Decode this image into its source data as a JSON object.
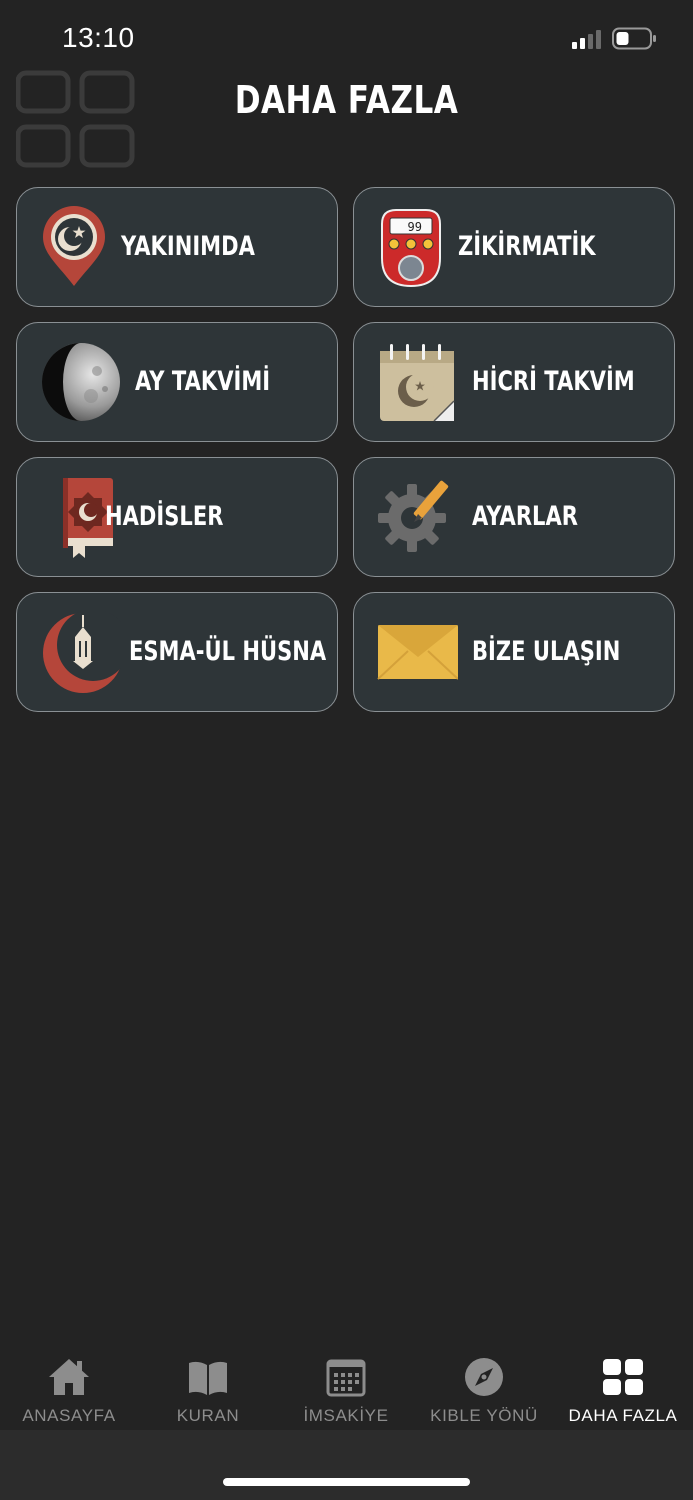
{
  "status_bar": {
    "time": "13:10",
    "signal_icon": "cellular-signal-icon",
    "battery_icon": "battery-icon"
  },
  "header": {
    "title": "DAHA FAZLA",
    "icon": "grid-icon"
  },
  "menu": {
    "items": [
      {
        "label": "YAKINIMDA",
        "icon": "location-pin-icon"
      },
      {
        "label": "ZİKİRMATİK",
        "icon": "tally-counter-icon"
      },
      {
        "label": "AY TAKVİMİ",
        "icon": "moon-icon"
      },
      {
        "label": "HİCRİ TAKVİM",
        "icon": "calendar-icon"
      },
      {
        "label": "HADİSLER",
        "icon": "book-icon"
      },
      {
        "label": "AYARLAR",
        "icon": "settings-gear-icon"
      },
      {
        "label": "ESMA-ÜL HÜSNA",
        "icon": "crescent-lantern-icon"
      },
      {
        "label": "BİZE ULAŞIN",
        "icon": "envelope-icon"
      }
    ]
  },
  "tab_bar": {
    "tabs": [
      {
        "label": "ANASAYFA",
        "icon": "home-icon",
        "active": false
      },
      {
        "label": "KURAN",
        "icon": "open-book-icon",
        "active": false
      },
      {
        "label": "İMSAKİYE",
        "icon": "calendar-grid-icon",
        "active": false
      },
      {
        "label": "KIBLE YÖNÜ",
        "icon": "compass-icon",
        "active": false
      },
      {
        "label": "DAHA FAZLA",
        "icon": "grid-icon",
        "active": true
      }
    ]
  },
  "colors": {
    "background": "#232323",
    "card": "#2e3538",
    "card_border": "#8a9094",
    "tab_inactive": "#8d8d8d",
    "tab_active": "#ffffff",
    "accent_red": "#b5463a"
  }
}
